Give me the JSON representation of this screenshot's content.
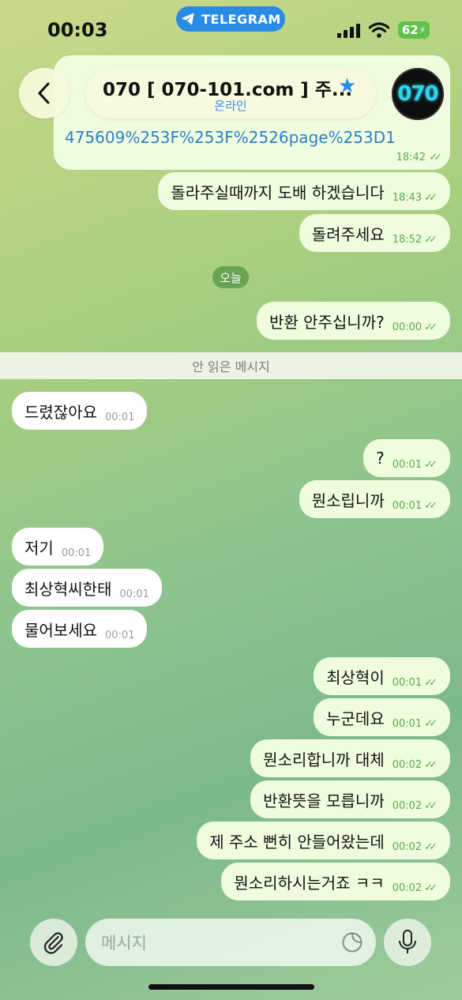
{
  "status_bar": {
    "time": "00:03",
    "app_pill": "TELEGRAM",
    "battery": "62"
  },
  "header": {
    "title": "070 [ 070-101.com ] 주...",
    "subtitle": "온라인",
    "avatar_text": "070"
  },
  "link_message": {
    "partial_url_line": "475609%253F%253F%2526page%253D1",
    "time": "18:42"
  },
  "messages_before": [
    {
      "text": "돌라주실때까지 도배 하겠습니다",
      "time": "18:43",
      "side": "out"
    },
    {
      "text": "돌려주세요",
      "time": "18:52",
      "side": "out"
    }
  ],
  "date_separator": "오늘",
  "message_today_first": {
    "text": "반환 안주십니까?",
    "time": "00:00"
  },
  "unread_separator": "안 읽은 메시지",
  "messages": [
    {
      "text": "드렸잖아요",
      "time": "00:01",
      "side": "in"
    },
    {
      "text": "?",
      "time": "00:01",
      "side": "out"
    },
    {
      "text": "뭔소립니까",
      "time": "00:01",
      "side": "out"
    },
    {
      "text": "저기",
      "time": "00:01",
      "side": "in"
    },
    {
      "text": "최상혁씨한태",
      "time": "00:01",
      "side": "in"
    },
    {
      "text": "물어보세요",
      "time": "00:01",
      "side": "in"
    },
    {
      "text": "최상혁이",
      "time": "00:01",
      "side": "out"
    },
    {
      "text": "누군데요",
      "time": "00:01",
      "side": "out"
    },
    {
      "text": "뭔소리합니까 대체",
      "time": "00:02",
      "side": "out"
    },
    {
      "text": "반환뜻을 모릅니까",
      "time": "00:02",
      "side": "out"
    },
    {
      "text": "제 주소 뻔히 안들어왔는데",
      "time": "00:02",
      "side": "out"
    },
    {
      "text": "뭔소리하시는거죠 ㅋㅋ",
      "time": "00:02",
      "side": "out"
    }
  ],
  "input": {
    "placeholder": "메시지"
  },
  "icons": {
    "back": "chevron-left-icon",
    "star": "star-icon",
    "attach": "paperclip-icon",
    "sticker": "sticker-icon",
    "mic": "microphone-icon",
    "signal": "signal-icon",
    "wifi": "wifi-icon",
    "telegram": "telegram-plane-icon",
    "read": "double-check-icon"
  },
  "colors": {
    "outgoing_bubble": "#effdde",
    "incoming_bubble": "#ffffff",
    "accent": "#2a8be6",
    "check": "#5ea84d",
    "battery": "#5ec24c"
  }
}
